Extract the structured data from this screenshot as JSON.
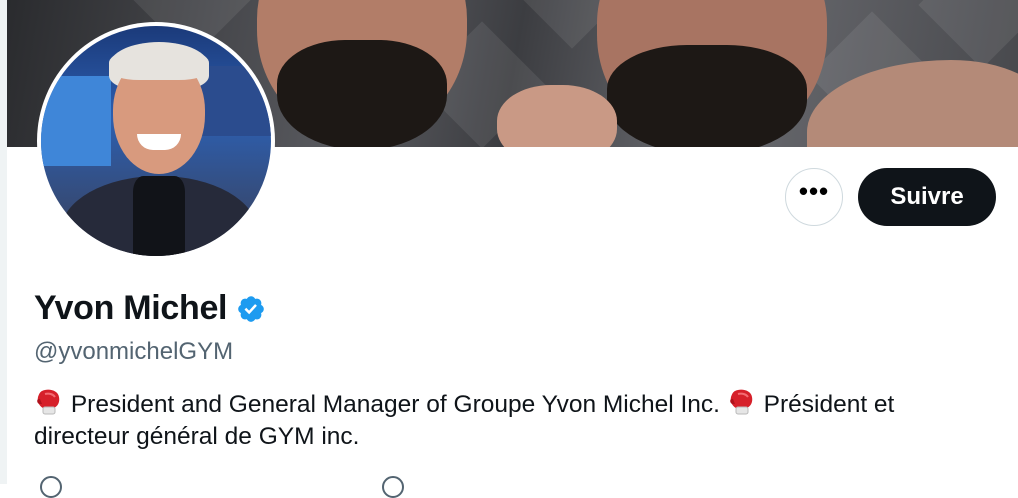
{
  "profile": {
    "name": "Yvon Michel",
    "handle": "@yvonmichelGYM",
    "verified": true,
    "bio_part1": "President and General Manager of Groupe Yvon Michel Inc.",
    "bio_part2": "Président et directeur général de GYM inc.",
    "bio_emoji": "boxing-glove-icon"
  },
  "actions": {
    "more_label": "•••",
    "follow_label": "Suivre"
  },
  "colors": {
    "follow_bg": "#0f1419",
    "verified_blue": "#1d9bf0",
    "handle_gray": "#536471",
    "border": "#cfd9de"
  }
}
